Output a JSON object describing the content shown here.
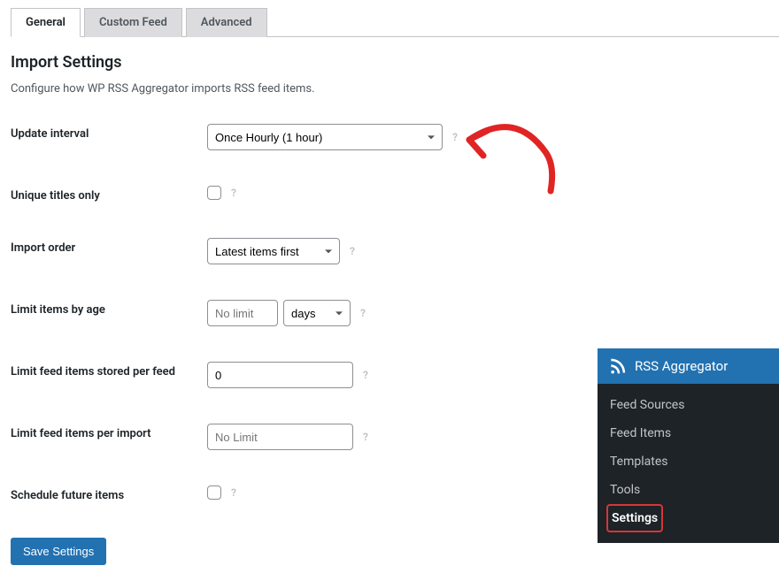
{
  "tabs": [
    {
      "label": "General",
      "active": true
    },
    {
      "label": "Custom Feed",
      "active": false
    },
    {
      "label": "Advanced",
      "active": false
    }
  ],
  "page": {
    "title": "Import Settings",
    "description": "Configure how WP RSS Aggregator imports RSS feed items."
  },
  "settings": {
    "update_interval": {
      "label": "Update interval",
      "value": "Once Hourly (1 hour)"
    },
    "unique_titles": {
      "label": "Unique titles only",
      "checked": false
    },
    "import_order": {
      "label": "Import order",
      "value": "Latest items first"
    },
    "limit_by_age": {
      "label": "Limit items by age",
      "value": "No limit",
      "unit": "days"
    },
    "limit_stored": {
      "label": "Limit feed items stored per feed",
      "value": "0"
    },
    "limit_per_import": {
      "label": "Limit feed items per import",
      "value": "No Limit"
    },
    "schedule_future": {
      "label": "Schedule future items",
      "checked": false
    }
  },
  "buttons": {
    "save": "Save Settings"
  },
  "sidebar": {
    "title": "RSS Aggregator",
    "items": [
      {
        "label": "Feed Sources",
        "active": false
      },
      {
        "label": "Feed Items",
        "active": false
      },
      {
        "label": "Templates",
        "active": false
      },
      {
        "label": "Tools",
        "active": false
      },
      {
        "label": "Settings",
        "active": true
      }
    ]
  }
}
